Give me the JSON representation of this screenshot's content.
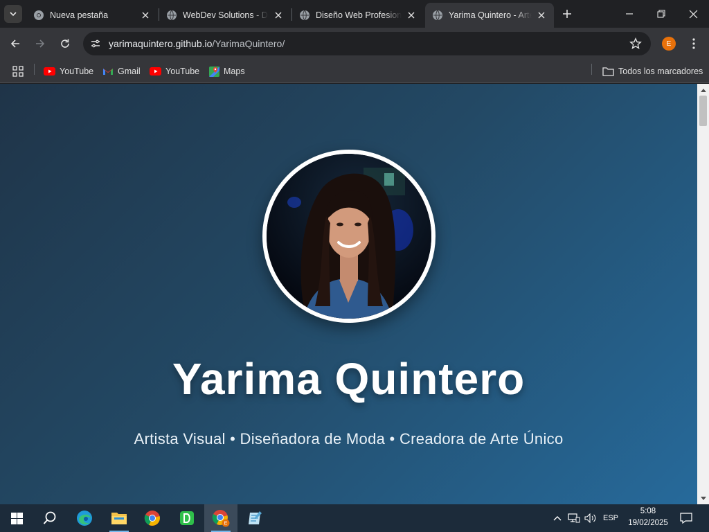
{
  "browser": {
    "tabs": [
      {
        "title": "Nueva pestaña",
        "icon": "chrome-icon"
      },
      {
        "title": "WebDev Solutions - Des",
        "icon": "globe-icon"
      },
      {
        "title": "Diseño Web Profesional",
        "icon": "globe-icon"
      },
      {
        "title": "Yarima Quintero - Arte",
        "icon": "globe-icon",
        "active": true
      }
    ],
    "url_host": "yarimaquintero.github.io",
    "url_path": "/YarimaQuintero/",
    "profile_initial": "E",
    "bookmarks": [
      {
        "label": "YouTube",
        "icon": "youtube-icon"
      },
      {
        "label": "Gmail",
        "icon": "gmail-icon"
      },
      {
        "label": "YouTube",
        "icon": "youtube-icon"
      },
      {
        "label": "Maps",
        "icon": "maps-icon"
      }
    ],
    "all_bookmarks_label": "Todos los marcadores"
  },
  "page": {
    "hero_name": "Yarima Quintero",
    "hero_subtitle": "Artista Visual • Diseñadora de Moda • Creadora de Arte Único"
  },
  "taskbar": {
    "apps": [
      "windows-start-icon",
      "search-icon",
      "edge-icon",
      "file-explorer-icon",
      "chrome-icon",
      "d-app-icon",
      "chrome-profile-icon",
      "notepad-icon"
    ],
    "language": "ESP",
    "time": "5:08",
    "date": "19/02/2025"
  },
  "colors": {
    "hero_gradient_start": "#1f3448",
    "hero_gradient_end": "#266a9b",
    "tab_active": "#35363a",
    "chrome_dark": "#202124",
    "profile_orange": "#e8710a"
  }
}
